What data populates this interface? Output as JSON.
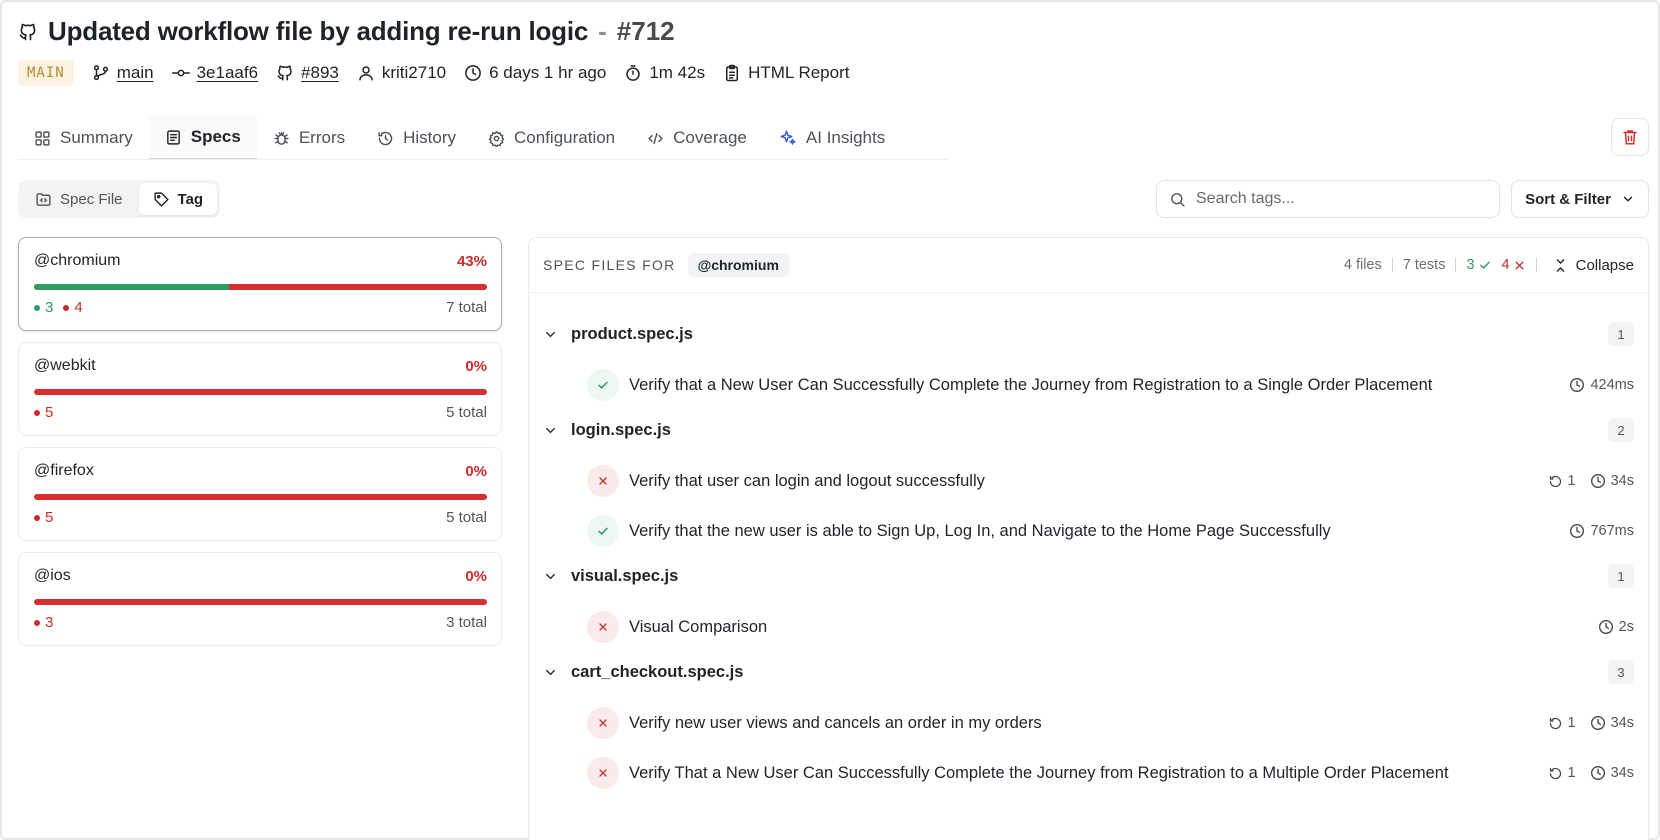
{
  "header": {
    "title": "Updated workflow file by adding re-run logic",
    "separator": "-",
    "run_number": "#712",
    "branch_badge": "MAIN",
    "branch": "main",
    "commit": "3e1aaf6",
    "pr": "#893",
    "author": "kriti2710",
    "time_ago": "6 days 1 hr ago",
    "duration": "1m 42s",
    "report": "HTML Report"
  },
  "tabs": [
    {
      "label": "Summary",
      "icon": "grid-icon"
    },
    {
      "label": "Specs",
      "icon": "document-icon",
      "active": true
    },
    {
      "label": "Errors",
      "icon": "bug-icon"
    },
    {
      "label": "History",
      "icon": "history-icon"
    },
    {
      "label": "Configuration",
      "icon": "gear-icon"
    },
    {
      "label": "Coverage",
      "icon": "code-icon"
    },
    {
      "label": "AI Insights",
      "icon": "sparkle-icon"
    }
  ],
  "view_toggle": {
    "spec_file": "Spec File",
    "tag": "Tag",
    "active": "Tag"
  },
  "search": {
    "placeholder": "Search tags..."
  },
  "sort_filter": "Sort & Filter",
  "tags": [
    {
      "name": "@chromium",
      "pct": "43%",
      "pass": 3,
      "fail": 4,
      "pass_display": "3",
      "fail_display": "4",
      "total": "7 total",
      "pass_fraction": 0.43,
      "selected": true
    },
    {
      "name": "@webkit",
      "pct": "0%",
      "pass": 0,
      "fail": 5,
      "fail_display": "5",
      "total": "5 total",
      "pass_fraction": 0
    },
    {
      "name": "@firefox",
      "pct": "0%",
      "pass": 0,
      "fail": 5,
      "fail_display": "5",
      "total": "5 total",
      "pass_fraction": 0
    },
    {
      "name": "@ios",
      "pct": "0%",
      "pass": 0,
      "fail": 3,
      "fail_display": "3",
      "total": "3 total",
      "pass_fraction": 0
    }
  ],
  "panel": {
    "label": "SPEC FILES FOR",
    "tag": "@chromium",
    "files": "4 files",
    "tests": "7 tests",
    "passed": "3",
    "failed": "4",
    "collapse": "Collapse"
  },
  "groups": [
    {
      "name": "product.spec.js",
      "count": "1",
      "tests": [
        {
          "name": "Verify that a New User Can Successfully Complete the Journey from Registration to a Single Order Placement",
          "status": "pass",
          "retries": "",
          "duration": "424ms"
        }
      ]
    },
    {
      "name": "login.spec.js",
      "count": "2",
      "tests": [
        {
          "name": "Verify that user can login and logout successfully",
          "status": "fail",
          "retries": "1",
          "duration": "34s"
        },
        {
          "name": "Verify that the new user is able to Sign Up, Log In, and Navigate to the Home Page Successfully",
          "status": "pass",
          "retries": "",
          "duration": "767ms"
        }
      ]
    },
    {
      "name": "visual.spec.js",
      "count": "1",
      "tests": [
        {
          "name": "Visual Comparison",
          "status": "fail",
          "retries": "",
          "duration": "2s"
        }
      ]
    },
    {
      "name": "cart_checkout.spec.js",
      "count": "3",
      "tests": [
        {
          "name": "Verify new user views and cancels an order in my orders",
          "status": "fail",
          "retries": "1",
          "duration": "34s"
        },
        {
          "name": "Verify That a New User Can Successfully Complete the Journey from Registration to a Multiple Order Placement",
          "status": "fail",
          "retries": "1",
          "duration": "34s"
        }
      ]
    }
  ],
  "colors": {
    "pass": "#2e9c62",
    "fail": "#d62f2f",
    "badge": "#b98a2a",
    "accent_ai": "#3b5bdb"
  }
}
